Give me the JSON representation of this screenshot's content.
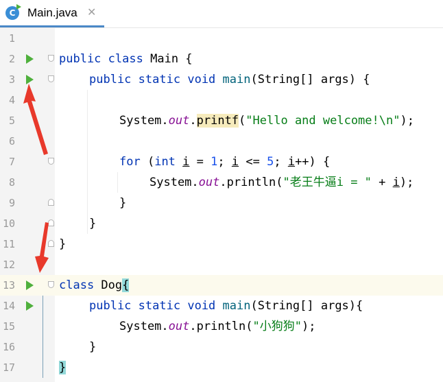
{
  "tab": {
    "icon_letter": "C",
    "label": "Main.java",
    "close": "✕"
  },
  "lines": [
    {
      "n": "1"
    },
    {
      "n": "2",
      "kw1": "public",
      "kw2": "class",
      "name": "Main",
      "tail": " {"
    },
    {
      "n": "3",
      "kw1": "public",
      "kw2": "static",
      "kw3": "void",
      "method": "main",
      "params": "(String[] args) {"
    },
    {
      "n": "4"
    },
    {
      "n": "5",
      "obj": "System.",
      "field": "out",
      "dot": ".",
      "method": "printf",
      "open": "(",
      "str": "\"Hello and welcome!\\n\"",
      "close": ");"
    },
    {
      "n": "6"
    },
    {
      "n": "7",
      "kw_for": "for",
      "p1": " (",
      "kw_int": "int",
      "sp": " ",
      "var1": "i",
      "eq": " = ",
      "num1": "1",
      "semi1": "; ",
      "var2": "i",
      "lt": " <= ",
      "num2": "5",
      "semi2": "; ",
      "var3": "i",
      "inc": "++) {"
    },
    {
      "n": "8",
      "obj": "System.",
      "field": "out",
      "rest": ".println(",
      "str": "\"老王牛逼i = \"",
      "plus": " + ",
      "var": "i",
      "close": ");"
    },
    {
      "n": "9",
      "text": "}"
    },
    {
      "n": "10",
      "text": "}"
    },
    {
      "n": "11",
      "text": "}"
    },
    {
      "n": "12"
    },
    {
      "n": "13",
      "kw": "class",
      "name": " Dog",
      "brace": "{"
    },
    {
      "n": "14",
      "kw1": "public",
      "kw2": "static",
      "kw3": "void",
      "method": "main",
      "params": "(String[] args){"
    },
    {
      "n": "15",
      "obj": "System.",
      "field": "out",
      "rest": ".println(",
      "str": "\"小狗狗\"",
      "close": ");"
    },
    {
      "n": "16",
      "text": "}"
    },
    {
      "n": "17",
      "text": "}"
    }
  ],
  "colors": {
    "keyword": "#0033b3",
    "string": "#067d17",
    "field": "#871094",
    "number": "#1750eb",
    "run": "#4fb03c",
    "arrow": "#e8392b"
  }
}
